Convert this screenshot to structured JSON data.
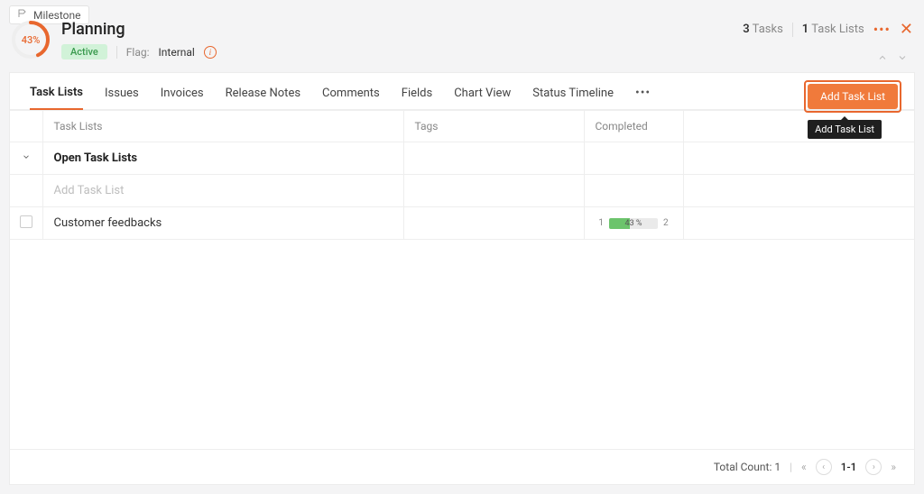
{
  "breadcrumb": {
    "label": "Milestone"
  },
  "header": {
    "title": "Planning",
    "progress_pct": 43,
    "progress_label": "43%",
    "status_badge": "Active",
    "flag_label": "Flag:",
    "flag_value": "Internal",
    "counts": {
      "tasks_n": "3",
      "tasks_lbl": "Tasks",
      "lists_n": "1",
      "lists_lbl": "Task Lists"
    }
  },
  "tabs": {
    "items": [
      "Task Lists",
      "Issues",
      "Invoices",
      "Release Notes",
      "Comments",
      "Fields",
      "Chart View",
      "Status Timeline"
    ],
    "active_index": 0
  },
  "actions": {
    "add_tasklist_label": "Add Task List",
    "add_tasklist_tooltip": "Add Task List"
  },
  "table": {
    "columns": {
      "tasklists": "Task Lists",
      "tags": "Tags",
      "completed": "Completed"
    },
    "group_name": "Open Task Lists",
    "add_placeholder": "Add Task List",
    "rows": [
      {
        "name": "Customer feedbacks",
        "done": "1",
        "pct_label": "43 %",
        "pct_value": 43,
        "total": "2"
      }
    ]
  },
  "footer": {
    "total_label": "Total Count:",
    "total_value": "1",
    "range": "1-1"
  },
  "colors": {
    "accent": "#e8672e"
  }
}
